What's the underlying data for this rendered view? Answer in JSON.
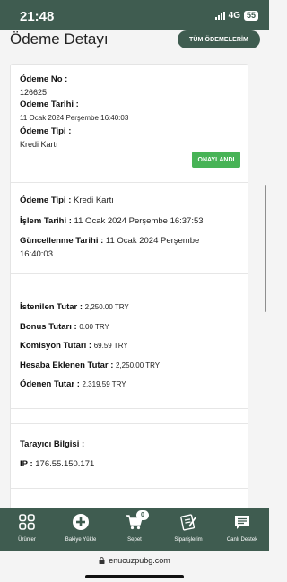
{
  "status_bar": {
    "time": "21:48",
    "network": "4G",
    "battery": "55"
  },
  "header": {
    "title": "Ödeme Detayı",
    "all_payments_button": "TÜM ÖDEMELERİM"
  },
  "payment": {
    "no_label": "Ödeme No :",
    "no_value": "126625",
    "date_label": "Ödeme Tarihi :",
    "date_value": "11 Ocak 2024 Perşembe 16:40:03",
    "type_label": "Ödeme Tipi :",
    "type_value": "Kredi Kartı",
    "status": "ONAYLANDI"
  },
  "details": {
    "type_label": "Ödeme Tipi :",
    "type_value": "Kredi Kartı",
    "txn_date_label": "İşlem Tarihi :",
    "txn_date_value": "11 Ocak 2024 Perşembe 16:37:53",
    "updated_label": "Güncellenme Tarihi :",
    "updated_value_line1": "11 Ocak 2024 Perşembe",
    "updated_value_line2": "16:40:03"
  },
  "amounts": {
    "requested_label": "İstenilen Tutar :",
    "requested_value": "2,250.00 TRY",
    "bonus_label": "Bonus Tutarı :",
    "bonus_value": "0.00 TRY",
    "commission_label": "Komisyon Tutarı :",
    "commission_value": "69.59 TRY",
    "credited_label": "Hesaba Eklenen Tutar :",
    "credited_value": "2,250.00 TRY",
    "paid_label": "Ödenen Tutar :",
    "paid_value": "2,319.59 TRY"
  },
  "browser": {
    "title_label": "Tarayıcı Bilgisi :",
    "ip_label": "IP :",
    "ip_value": "176.55.150.171"
  },
  "tabs": [
    {
      "label": "Ürünler",
      "icon": "grid-icon"
    },
    {
      "label": "Bakiye Yükle",
      "icon": "plus-circle-icon"
    },
    {
      "label": "Sepet",
      "icon": "cart-icon",
      "badge": "0"
    },
    {
      "label": "Siparişlerim",
      "icon": "orders-icon"
    },
    {
      "label": "Canlı Destek",
      "icon": "chat-icon"
    }
  ],
  "url_bar": {
    "url": "enucuzpubg.com"
  },
  "colors": {
    "brand": "#3f5c50",
    "success": "#47b356"
  }
}
